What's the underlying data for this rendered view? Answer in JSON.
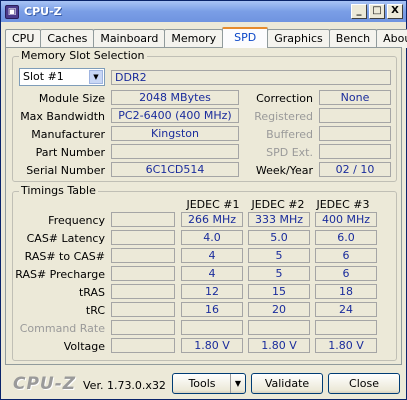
{
  "window": {
    "title": "CPU-Z",
    "icon": "cpu-z-icon",
    "minimize": "_",
    "maximize": "□",
    "close": "X"
  },
  "tabs": [
    {
      "label": "CPU"
    },
    {
      "label": "Caches"
    },
    {
      "label": "Mainboard"
    },
    {
      "label": "Memory"
    },
    {
      "label": "SPD",
      "active": true
    },
    {
      "label": "Graphics"
    },
    {
      "label": "Bench"
    },
    {
      "label": "About"
    }
  ],
  "memory_slot": {
    "group_title": "Memory Slot Selection",
    "slot_value": "Slot #1",
    "type": "DDR2",
    "labels": {
      "module_size": "Module Size",
      "max_bandwidth": "Max Bandwidth",
      "manufacturer": "Manufacturer",
      "part_number": "Part Number",
      "serial_number": "Serial Number",
      "correction": "Correction",
      "registered": "Registered",
      "buffered": "Buffered",
      "spd_ext": "SPD Ext.",
      "week_year": "Week/Year"
    },
    "values": {
      "module_size": "2048 MBytes",
      "max_bandwidth": "PC2-6400 (400 MHz)",
      "manufacturer": "Kingston",
      "part_number": "",
      "serial_number": "6C1CD514",
      "correction": "None",
      "registered": "",
      "buffered": "",
      "spd_ext": "",
      "week_year": "02 / 10"
    }
  },
  "timings": {
    "group_title": "Timings Table",
    "columns": [
      "JEDEC #1",
      "JEDEC #2",
      "JEDEC #3"
    ],
    "rows": [
      {
        "label": "Frequency",
        "values": [
          "266 MHz",
          "333 MHz",
          "400 MHz"
        ]
      },
      {
        "label": "CAS# Latency",
        "values": [
          "4.0",
          "5.0",
          "6.0"
        ]
      },
      {
        "label": "RAS# to CAS#",
        "values": [
          "4",
          "5",
          "6"
        ]
      },
      {
        "label": "RAS# Precharge",
        "values": [
          "4",
          "5",
          "6"
        ]
      },
      {
        "label": "tRAS",
        "values": [
          "12",
          "15",
          "18"
        ]
      },
      {
        "label": "tRC",
        "values": [
          "16",
          "20",
          "24"
        ]
      },
      {
        "label": "Command Rate",
        "values": [
          "",
          "",
          ""
        ],
        "dim": true
      },
      {
        "label": "Voltage",
        "values": [
          "1.80 V",
          "1.80 V",
          "1.80 V"
        ]
      }
    ]
  },
  "footer": {
    "logo": "CPU-Z",
    "version": "Ver. 1.73.0.x32",
    "tools_label": "Tools",
    "validate_label": "Validate",
    "close_label": "Close"
  }
}
